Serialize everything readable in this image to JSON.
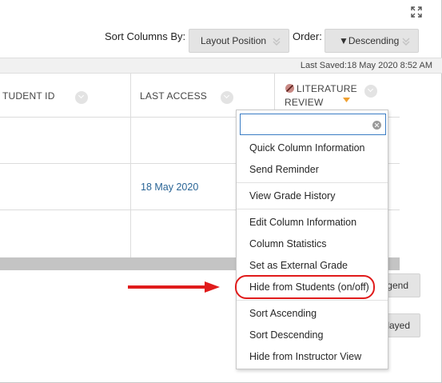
{
  "header": {
    "sort_columns_label": "Sort Columns By:",
    "sort_columns_value": "Layout Position",
    "order_label": "Order:",
    "order_value": "▼Descending"
  },
  "last_saved": "Last Saved:18 May 2020 8:52 AM",
  "columns": {
    "student_id": "TUDENT ID",
    "last_access": "LAST ACCESS",
    "literature_review_line1": "LITERATURE",
    "literature_review_line2": "REVIEW"
  },
  "rows": [
    {
      "last_access": ""
    },
    {
      "last_access": "18 May 2020"
    },
    {
      "last_access": ""
    }
  ],
  "partial_buttons": {
    "legend": "gend",
    "displayed": "layed"
  },
  "context_menu": {
    "search_placeholder": "",
    "items": [
      "Quick Column Information",
      "Send Reminder",
      "View Grade History",
      "Edit Column Information",
      "Column Statistics",
      "Set as External Grade",
      "Hide from Students (on/off)",
      "Sort Ascending",
      "Sort Descending",
      "Hide from Instructor View"
    ],
    "highlighted_item": "Hide from Students (on/off)"
  },
  "colors": {
    "annotation_red": "#e01b1b",
    "link_blue": "#2a6596",
    "accent_orange": "#f0a030",
    "search_border": "#3b7dc4"
  },
  "icons": [
    "expand-icon",
    "chevron-down-icon",
    "clear-icon",
    "hidden-column-icon",
    "annotation-arrow"
  ]
}
